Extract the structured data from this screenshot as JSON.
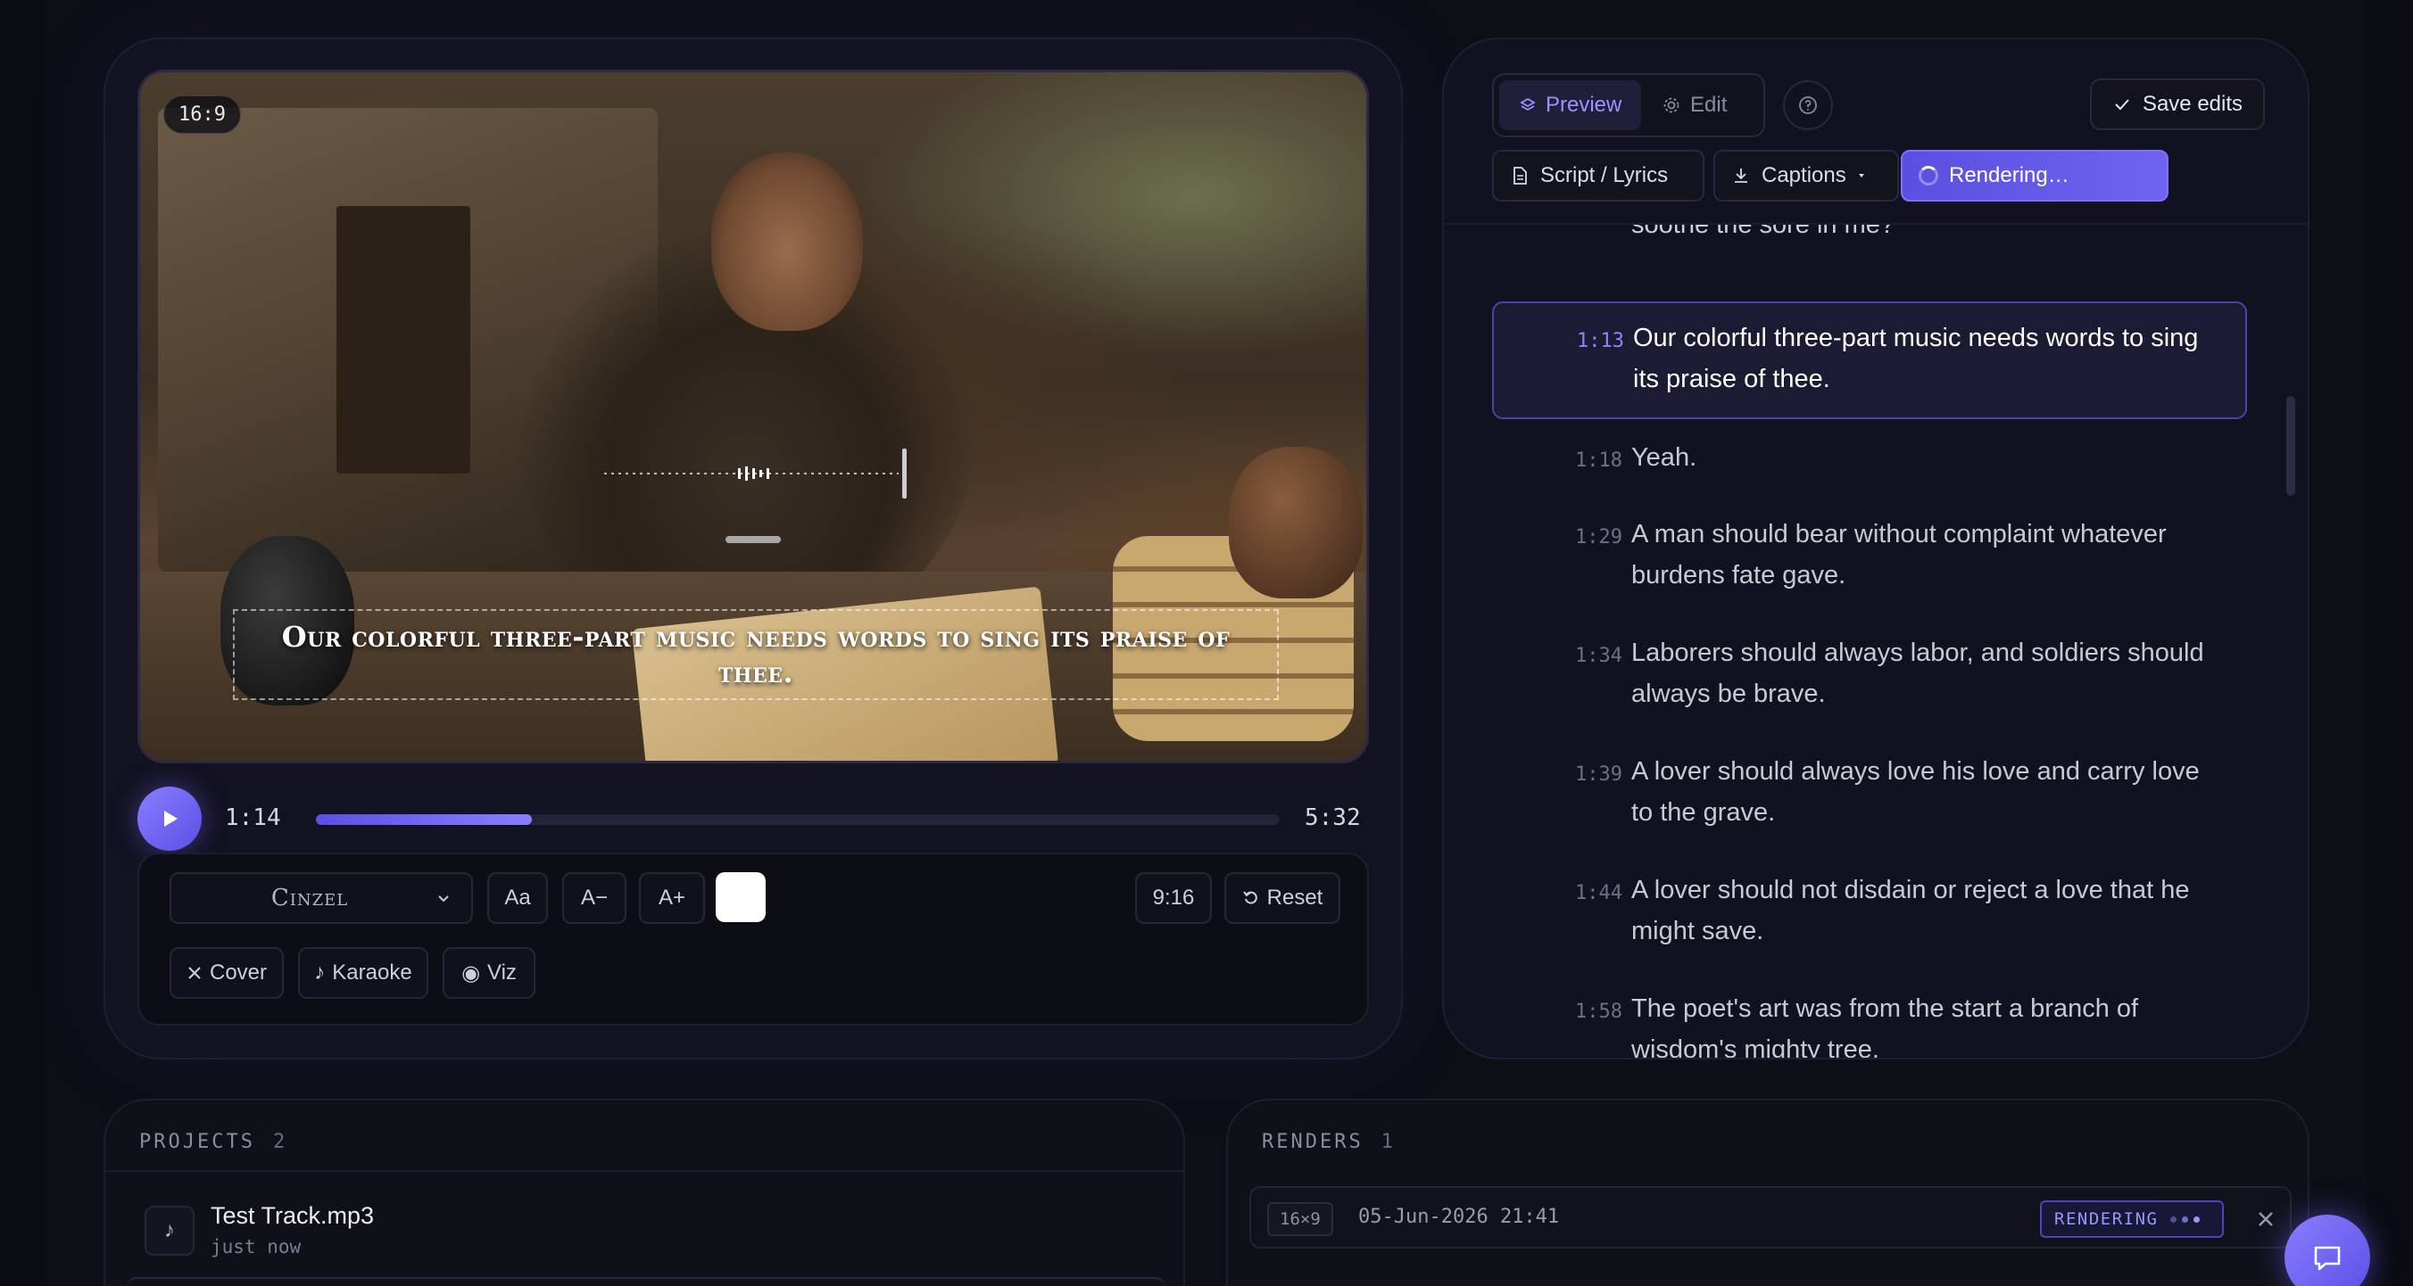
{
  "player": {
    "aspect_badge": "16:9",
    "caption": "Our colorful three-part music needs words to sing its praise of thee.",
    "current_time": "1:14",
    "total_time": "5:32",
    "progress": 0.224
  },
  "controls": {
    "font_name": "Cinzel",
    "size_reset_label": "Aa",
    "size_down_label": "A−",
    "size_up_label": "A+",
    "caption_color": "#ffffff",
    "ratio_label": "9:16",
    "reset_label": "Reset",
    "cover_label": "Cover",
    "karaoke_label": "Karaoke",
    "viz_label": "Viz"
  },
  "editor": {
    "tabs": [
      {
        "label": "Preview",
        "active": true
      },
      {
        "label": "Edit",
        "active": false
      }
    ],
    "save_label": "Save edits",
    "script_label": "Script / Lyrics",
    "captions_label": "Captions",
    "rendering_label": "Rendering…"
  },
  "lyrics": {
    "partial_line": "soothe the sore in me?",
    "lines": [
      {
        "time": "1:13",
        "text": "Our colorful three-part music needs words to sing its praise of thee.",
        "active": true
      },
      {
        "time": "1:18",
        "text": "Yeah.",
        "active": false
      },
      {
        "time": "1:29",
        "text": "A man should bear without complaint whatever burdens fate gave.",
        "active": false
      },
      {
        "time": "1:34",
        "text": "Laborers should always labor, and soldiers should always be brave.",
        "active": false
      },
      {
        "time": "1:39",
        "text": "A lover should always love his love and carry love to the grave.",
        "active": false
      },
      {
        "time": "1:44",
        "text": "A lover should not disdain or reject a love that he might save.",
        "active": false
      },
      {
        "time": "1:58",
        "text": "The poet's art was from the start a branch of wisdom's mighty tree.",
        "active": false
      }
    ]
  },
  "projects": {
    "title": "PROJECTS",
    "count": "2",
    "items": [
      {
        "name": "Test Track.mp3",
        "time": "just now"
      }
    ]
  },
  "renders": {
    "title": "RENDERS",
    "count": "1",
    "items": [
      {
        "ratio": "16×9",
        "date": "05-Jun-2026 21:41",
        "status": "RENDERING"
      }
    ]
  },
  "colors": {
    "accent": "#6f63f0",
    "background": "#0b0b13"
  }
}
